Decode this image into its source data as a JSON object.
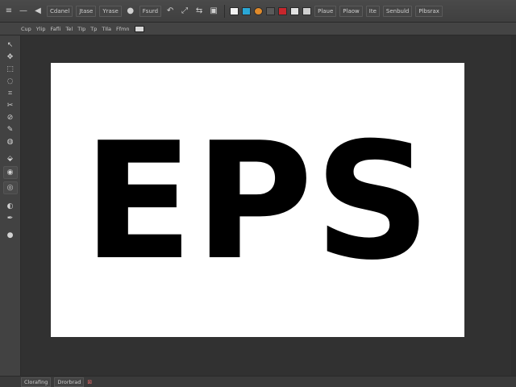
{
  "toolbar": {
    "icons": [
      "list-icon",
      "pin-icon",
      "arrow-icon"
    ],
    "menus": [
      "Cdanel",
      "Jtase",
      "Yrase",
      "Fsurd",
      "Plaue",
      "Plaow",
      "Ite",
      "Senbuld",
      "Plbsrax"
    ],
    "tool_glyphs": [
      "—",
      "◀",
      "●",
      "↶",
      "⤢",
      "⇆",
      "▣"
    ],
    "swatch_colors": [
      "#f2f2f2",
      "#2aa7d6",
      "#e08a2a",
      "#5a5a5a",
      "#c8262c",
      "#e2e2e2",
      "#cfcfcf"
    ]
  },
  "options": {
    "items": [
      "Cup",
      "Ylip",
      "Fafli",
      "Tel",
      "TIp",
      "Tp",
      "TIla",
      "Ffmn"
    ],
    "zoom_label": "TIp"
  },
  "tools": [
    "↖",
    "✥",
    "⬚",
    "◌",
    "⌗",
    "✂",
    "⊘",
    "✎",
    "◍",
    "⬙",
    "◉",
    "◎",
    "◐",
    "✒",
    "●"
  ],
  "canvas": {
    "text": "EPS"
  },
  "status": {
    "fields": [
      "Clorafing",
      "Drorbrad"
    ],
    "icon_glyph": "⊠"
  }
}
